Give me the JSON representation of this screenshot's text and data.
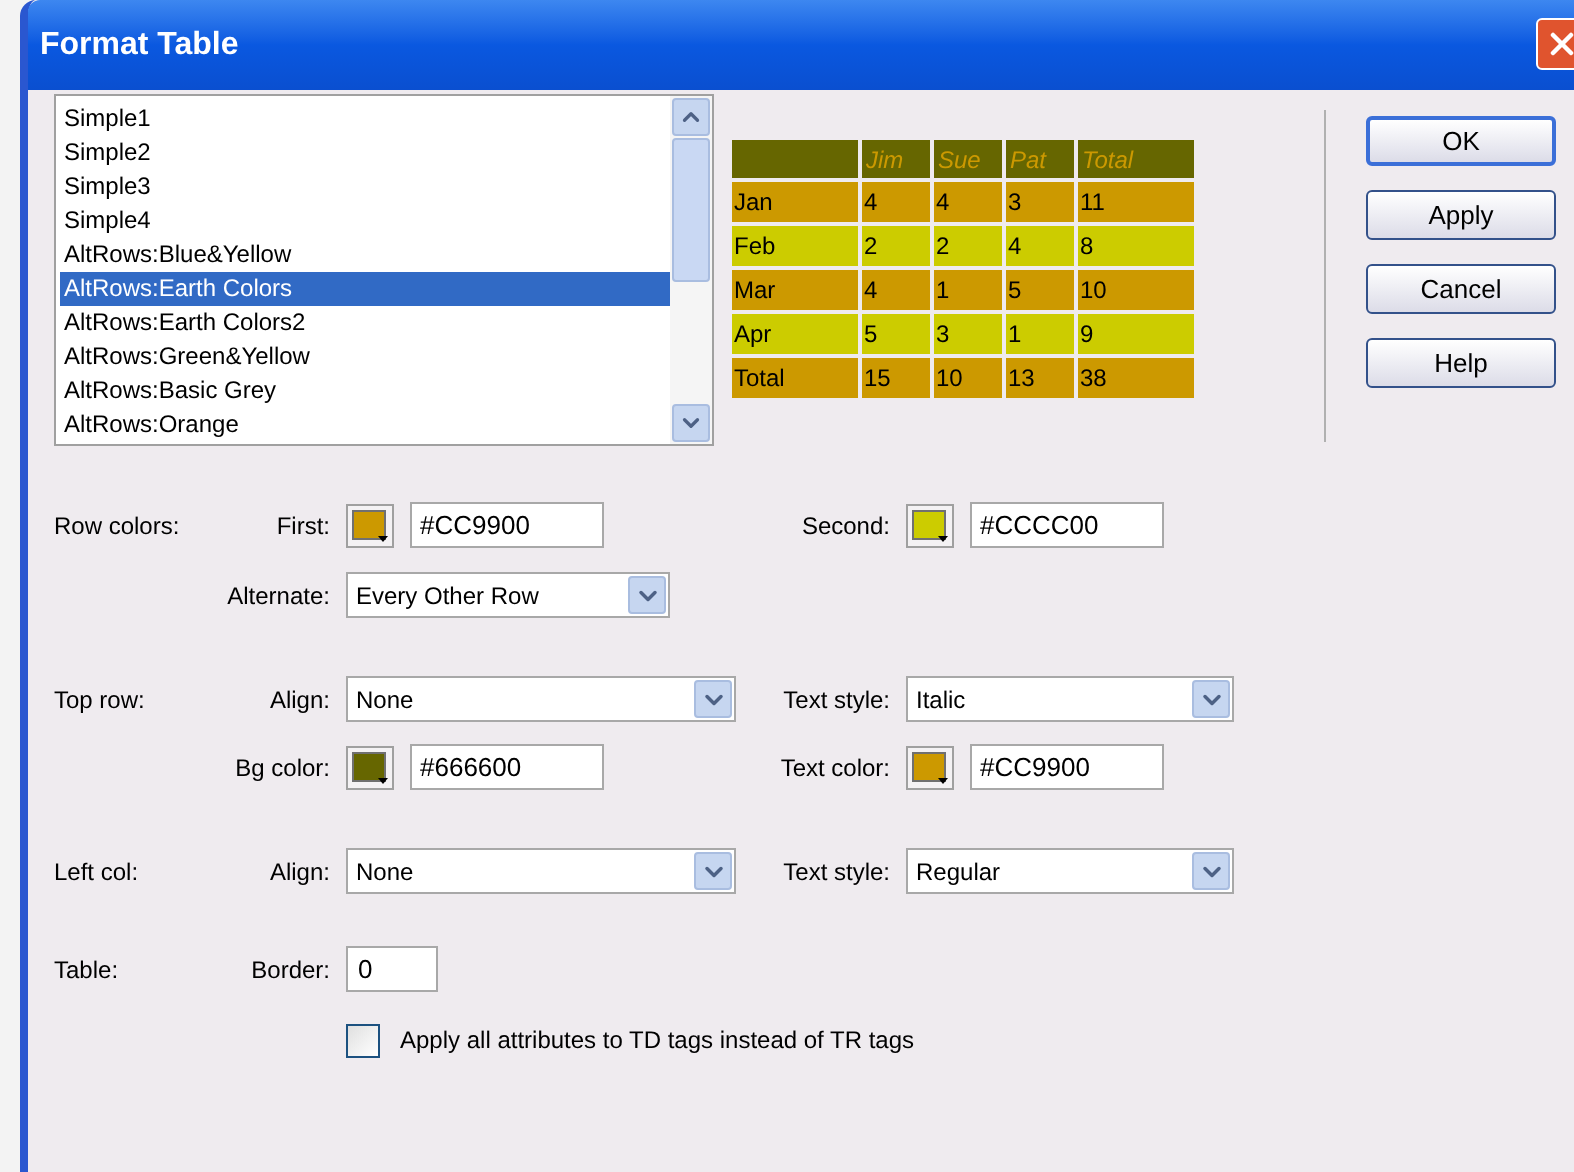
{
  "window": {
    "title": "Format Table"
  },
  "styles_list": {
    "items": [
      {
        "label": "Simple1",
        "selected": false
      },
      {
        "label": "Simple2",
        "selected": false
      },
      {
        "label": "Simple3",
        "selected": false
      },
      {
        "label": "Simple4",
        "selected": false
      },
      {
        "label": "AltRows:Blue&Yellow",
        "selected": false
      },
      {
        "label": "AltRows:Earth Colors",
        "selected": true
      },
      {
        "label": "AltRows:Earth Colors2",
        "selected": false
      },
      {
        "label": "AltRows:Green&Yellow",
        "selected": false
      },
      {
        "label": "AltRows:Basic Grey",
        "selected": false
      },
      {
        "label": "AltRows:Orange",
        "selected": false
      }
    ]
  },
  "preview_table": {
    "header": {
      "color": "#666600",
      "cells": [
        "Jim",
        "Sue",
        "Pat",
        "Total"
      ]
    },
    "rows": [
      {
        "color": "#cc9900",
        "cells": [
          "Jan",
          "4",
          "4",
          "3",
          "11"
        ]
      },
      {
        "color": "#cccc00",
        "cells": [
          "Feb",
          "2",
          "2",
          "4",
          "8"
        ]
      },
      {
        "color": "#cc9900",
        "cells": [
          "Mar",
          "4",
          "1",
          "5",
          "10"
        ]
      },
      {
        "color": "#cccc00",
        "cells": [
          "Apr",
          "5",
          "3",
          "1",
          "9"
        ]
      },
      {
        "color": "#cc9900",
        "cells": [
          "Total",
          "15",
          "10",
          "13",
          "38"
        ]
      }
    ]
  },
  "buttons": [
    {
      "label": "OK",
      "default": true
    },
    {
      "label": "Apply",
      "default": false
    },
    {
      "label": "Cancel",
      "default": false
    },
    {
      "label": "Help",
      "default": false
    }
  ],
  "row_colors": {
    "label": "Row colors:",
    "first": {
      "label": "First:",
      "color": "#cc9900",
      "value": "#CC9900"
    },
    "second": {
      "label": "Second:",
      "color": "#cccc00",
      "value": "#CCCC00"
    },
    "alternate": {
      "label": "Alternate:",
      "value": "Every Other Row"
    }
  },
  "top_row": {
    "label": "Top row:",
    "align": {
      "label": "Align:",
      "value": "None"
    },
    "text_style": {
      "label": "Text style:",
      "value": "Italic"
    },
    "bg_color": {
      "label": "Bg color:",
      "color": "#666600",
      "value": "#666600"
    },
    "text_color": {
      "label": "Text color:",
      "color": "#cc9900",
      "value": "#CC9900"
    }
  },
  "left_col": {
    "label": "Left col:",
    "align": {
      "label": "Align:",
      "value": "None"
    },
    "text_style": {
      "label": "Text style:",
      "value": "Regular"
    }
  },
  "table": {
    "label": "Table:",
    "border": {
      "label": "Border:",
      "value": "0"
    }
  },
  "td_checkbox": {
    "label": "Apply all attributes to TD tags instead of TR tags",
    "checked": false
  }
}
